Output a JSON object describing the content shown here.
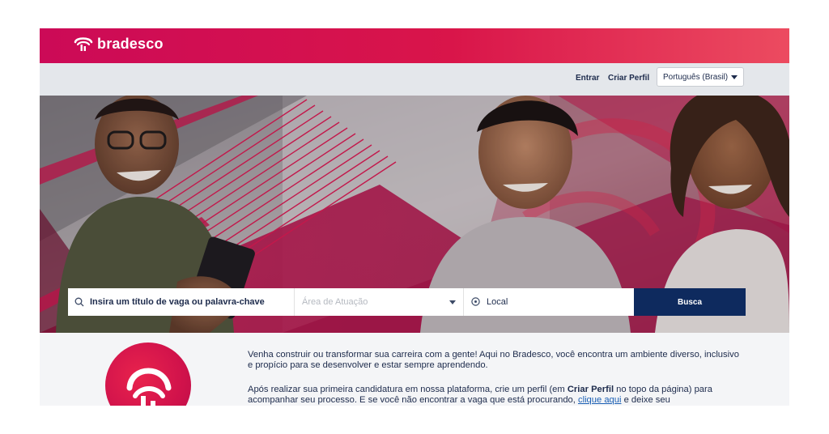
{
  "brand": {
    "name": "bradesco",
    "color": "#cc0a57"
  },
  "topnav": {
    "login_label": "Entrar",
    "create_profile_label": "Criar Perfil",
    "language_selected": "Português (Brasil)"
  },
  "search": {
    "keyword_placeholder": "Insira um título de vaga ou palavra-chave",
    "area_placeholder": "Área de Atuação",
    "location_placeholder": "Local",
    "button_label": "Busca"
  },
  "intro": {
    "paragraph1": "Venha construir ou transformar sua carreira com a gente! Aqui no Bradesco, você encontra um ambiente diverso, inclusivo e propício para se desenvolver e estar sempre aprendendo.",
    "p2_before": "Após realizar sua primeira candidatura em nossa plataforma, crie um perfil (em ",
    "p2_bold": "Criar Perfil",
    "p2_middle": " no topo da página) para acompanhar seu processo. E se você não encontrar a vaga que está procurando, ",
    "p2_link": "clique aqui",
    "p2_after": " e deixe seu"
  },
  "icons": [
    "bradesco-logo-icon",
    "search-icon",
    "chevron-down-icon",
    "location-pin-icon"
  ]
}
